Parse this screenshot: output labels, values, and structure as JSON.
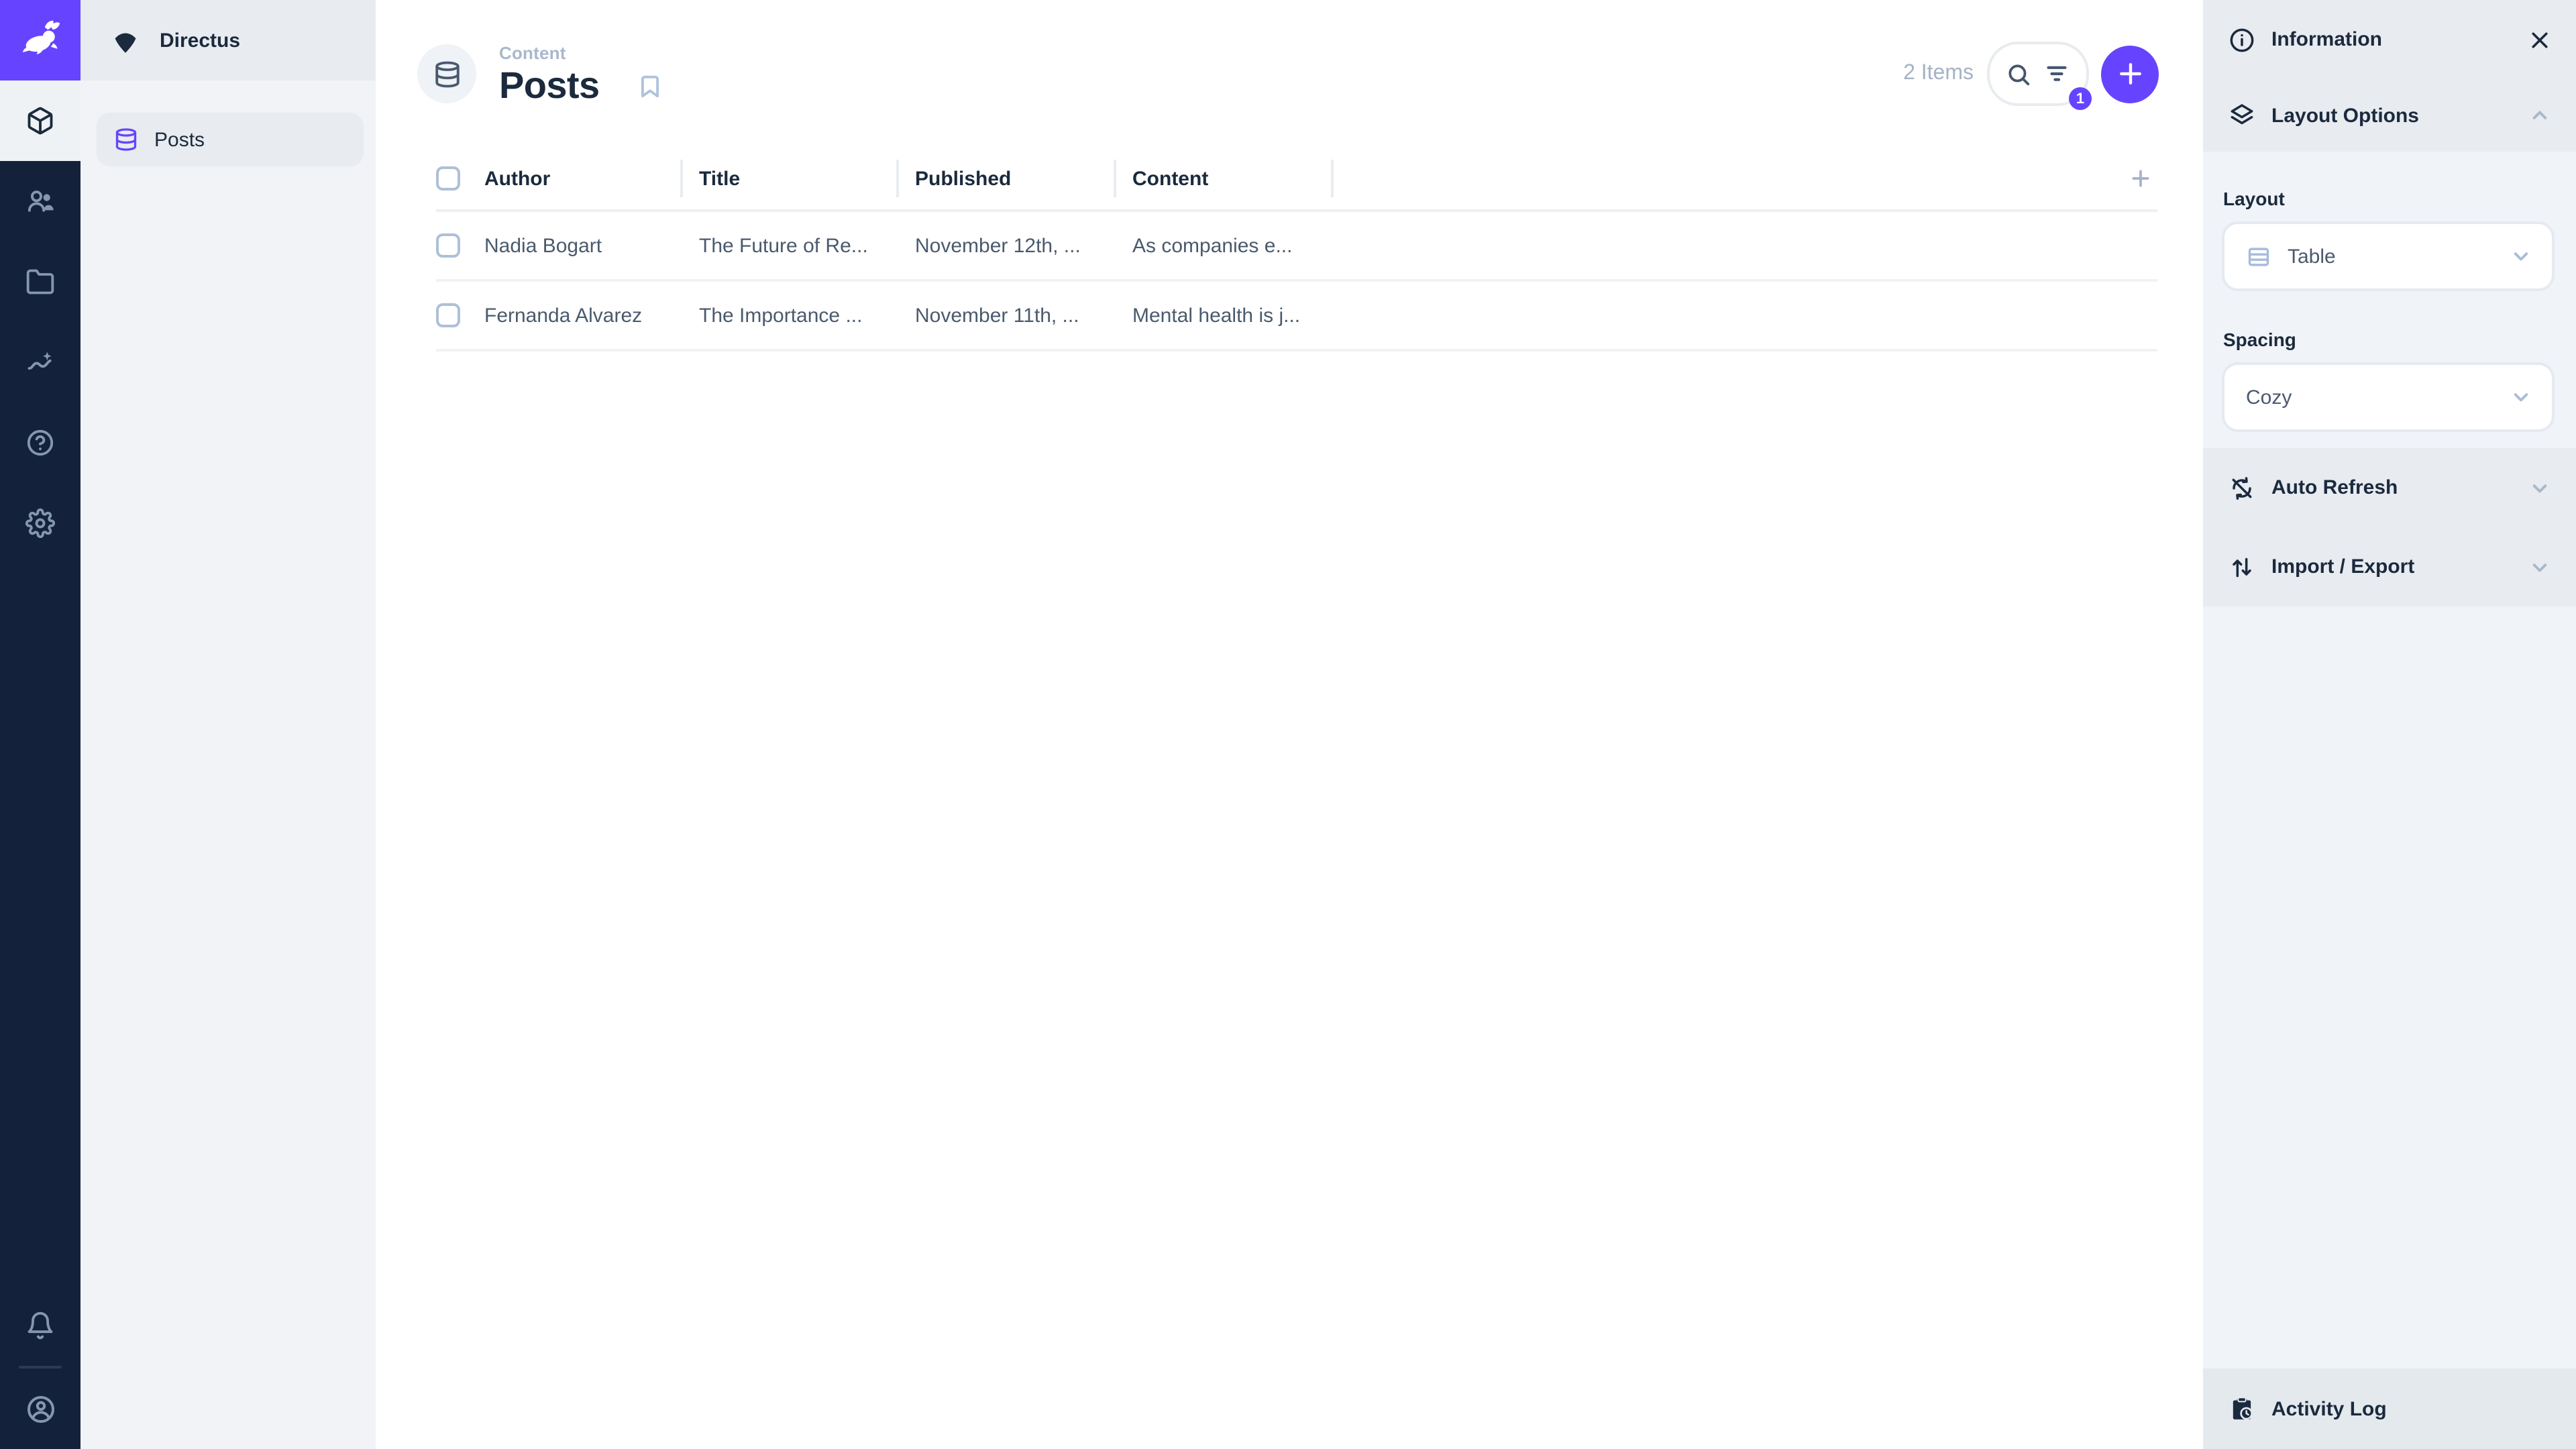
{
  "colors": {
    "accent": "#6644FF",
    "module_bar": "#14213A",
    "text_dark": "#1B2A3D",
    "text_muted": "#A5B3C4",
    "cell_text": "#4A5A6D"
  },
  "module_bar": {
    "modules": [
      {
        "icon": "box-icon",
        "name": "content",
        "active": true
      },
      {
        "icon": "users-icon",
        "name": "user-directory",
        "active": false
      },
      {
        "icon": "folder-icon",
        "name": "file-library",
        "active": false
      },
      {
        "icon": "insights-icon",
        "name": "insights",
        "active": false
      },
      {
        "icon": "help-icon",
        "name": "documentation",
        "active": false
      },
      {
        "icon": "gear-icon",
        "name": "settings",
        "active": false
      }
    ]
  },
  "nav": {
    "project_name": "Directus",
    "items": [
      {
        "label": "Posts",
        "icon": "database-icon",
        "active": true
      }
    ]
  },
  "header": {
    "breadcrumb": "Content",
    "title": "Posts",
    "item_count": "2 Items",
    "filter_badge": "1"
  },
  "table": {
    "columns": [
      "Author",
      "Title",
      "Published",
      "Content"
    ],
    "rows": [
      {
        "author": "Nadia Bogart",
        "title": "The Future of Re...",
        "published": "November 12th, ...",
        "content": "As companies e..."
      },
      {
        "author": "Fernanda Alvarez",
        "title": "The Importance ...",
        "published": "November 11th, ...",
        "content": "Mental health is j..."
      }
    ]
  },
  "sidebar": {
    "information_label": "Information",
    "layout_options_label": "Layout Options",
    "layout_label": "Layout",
    "layout_value": "Table",
    "spacing_label": "Spacing",
    "spacing_value": "Cozy",
    "auto_refresh_label": "Auto Refresh",
    "import_export_label": "Import / Export",
    "activity_log_label": "Activity Log"
  }
}
